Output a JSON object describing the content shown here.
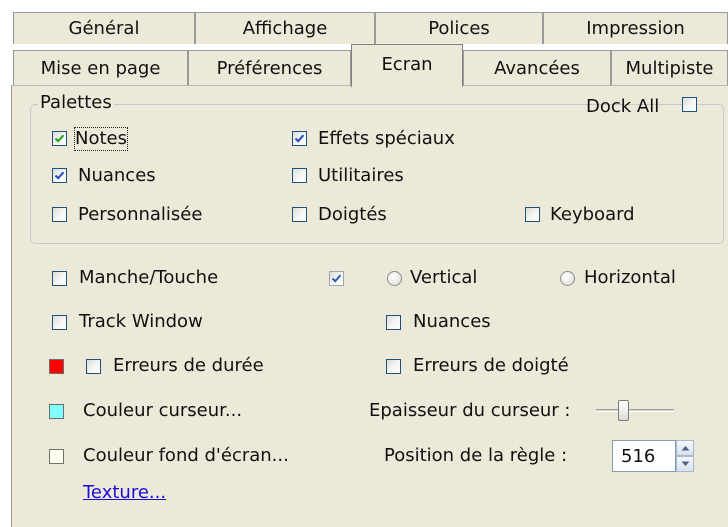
{
  "tabs": {
    "row1": [
      "Général",
      "Affichage",
      "Polices",
      "Impression"
    ],
    "row2": [
      "Mise en page",
      "Préférences",
      "Ecran",
      "Avancées",
      "Multipiste"
    ],
    "active": "Ecran"
  },
  "palettes": {
    "group_label": "Palettes",
    "dock_all": {
      "label": "Dock All",
      "checked": false
    },
    "notes": {
      "label": "Notes",
      "checked": true
    },
    "effets_speciaux": {
      "label": "Effets spéciaux",
      "checked": true
    },
    "nuances": {
      "label": "Nuances",
      "checked": true
    },
    "utilitaires": {
      "label": "Utilitaires",
      "checked": false
    },
    "personnalisee": {
      "label": "Personnalisée",
      "checked": false
    },
    "doigtes": {
      "label": "Doigtés",
      "checked": false
    },
    "keyboard": {
      "label": "Keyboard",
      "checked": false
    }
  },
  "options": {
    "manche_touche": {
      "label": "Manche/Touche",
      "checked": false
    },
    "orientation_enabled": {
      "checked": true
    },
    "vertical": {
      "label": "Vertical",
      "selected": false
    },
    "horizontal": {
      "label": "Horizontal",
      "selected": false
    },
    "track_window": {
      "label": "Track Window",
      "checked": false
    },
    "nuances2": {
      "label": "Nuances",
      "checked": false
    },
    "erreurs_duree": {
      "label": "Erreurs de durée",
      "checked": false,
      "color": "#ff0000"
    },
    "erreurs_doigte": {
      "label": "Erreurs de doigté",
      "checked": false
    },
    "couleur_curseur": {
      "label": "Couleur curseur...",
      "color": "#80ffff"
    },
    "epaisseur_curseur": {
      "label": "Epaisseur du curseur :"
    },
    "couleur_fond": {
      "label": "Couleur fond d'écran...",
      "color": "#fffff0"
    },
    "position_regle": {
      "label": "Position de la règle :",
      "value": "516"
    },
    "texture_link": "Texture..."
  }
}
